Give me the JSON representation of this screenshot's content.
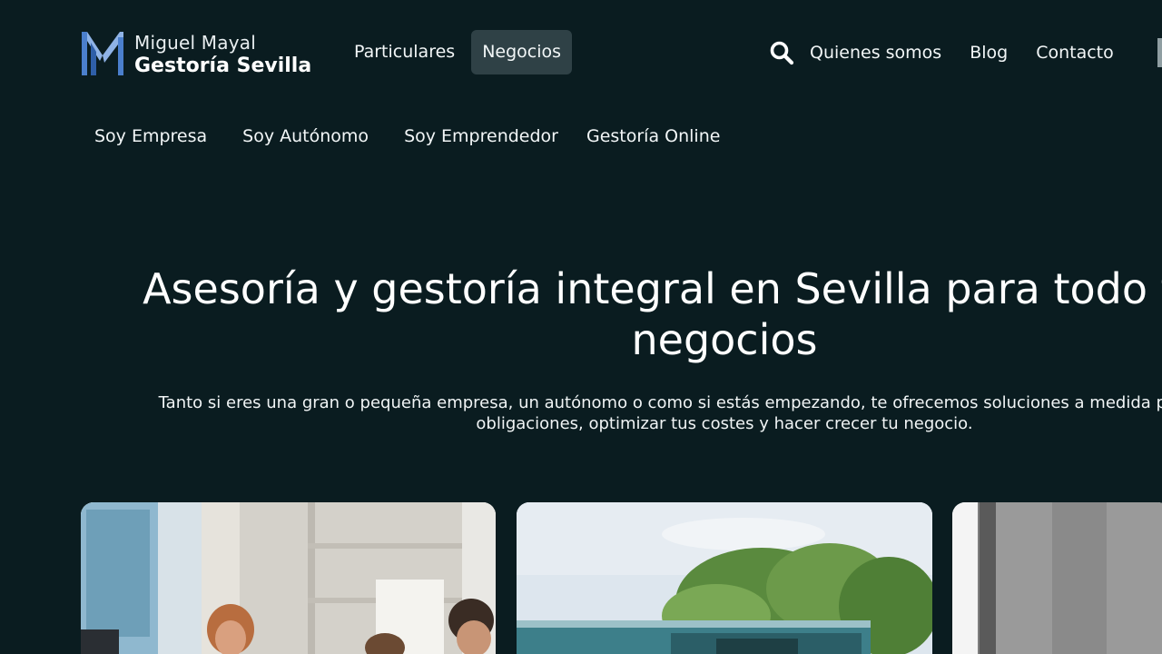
{
  "brand": {
    "line1": "Miguel Mayal",
    "line2": "Gestoría Sevilla",
    "logo_icon": "mm-logo-icon",
    "colors": {
      "logo_blue": "#4b7fcc",
      "logo_light": "#8fb3e6"
    }
  },
  "main_nav": {
    "items": [
      {
        "label": "Particulares",
        "active": false
      },
      {
        "label": "Negocios",
        "active": true
      }
    ]
  },
  "right_nav": {
    "search_icon": "search-icon",
    "items": [
      {
        "label": "Quienes somos"
      },
      {
        "label": "Blog"
      },
      {
        "label": "Contacto"
      }
    ]
  },
  "sub_nav": {
    "items": [
      {
        "label": "Soy Empresa"
      },
      {
        "label": "Soy Autónomo"
      },
      {
        "label": "Soy Emprendedor"
      },
      {
        "label": "Gestoría Online"
      }
    ]
  },
  "hero": {
    "title_line1": "Asesoría y gestoría integral en Sevilla para todo tipo de",
    "title_line2": "negocios",
    "text_line1": "Tanto si eres una gran o pequeña empresa, un autónomo o como si estás empezando, te ofrecemos soluciones a medida para cumplir tus",
    "text_line2": "obligaciones, optimizar tus costes y hacer crecer tu negocio."
  },
  "theme": {
    "background": "#0a1c20",
    "active_nav_bg": "#2f4146",
    "text": "#ffffff"
  }
}
